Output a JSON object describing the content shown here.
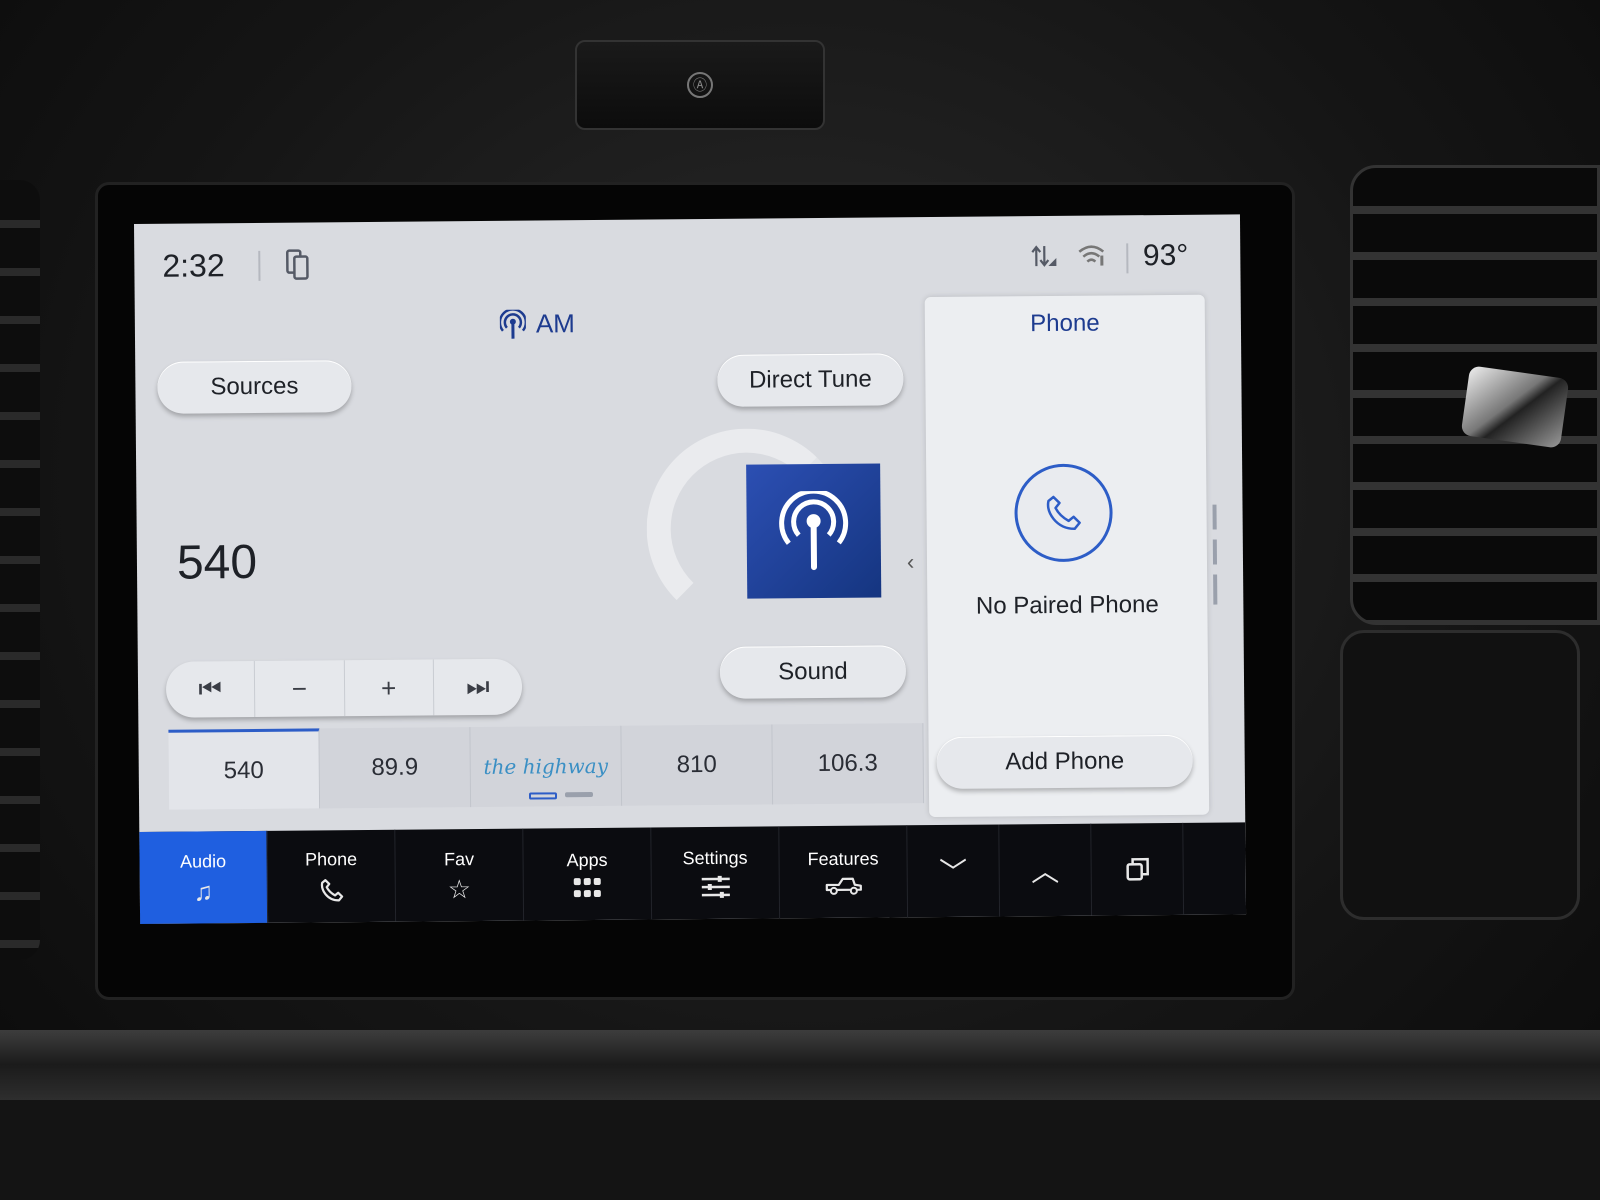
{
  "status_bar": {
    "time": "2:32",
    "temperature": "93°"
  },
  "audio": {
    "source": "AM",
    "sources_label": "Sources",
    "direct_tune_label": "Direct Tune",
    "sound_label": "Sound",
    "frequency": "540",
    "presets": [
      {
        "label": "540",
        "active": true
      },
      {
        "label": "89.9",
        "active": false
      },
      {
        "label": "the highway",
        "active": false,
        "logo": true
      },
      {
        "label": "810",
        "active": false
      },
      {
        "label": "106.3",
        "active": false
      }
    ]
  },
  "phone_panel": {
    "title": "Phone",
    "status": "No Paired Phone",
    "add_label": "Add Phone"
  },
  "nav": {
    "items": [
      {
        "label": "Audio",
        "icon": "music-note-icon",
        "active": true
      },
      {
        "label": "Phone",
        "icon": "phone-icon",
        "active": false
      },
      {
        "label": "Fav",
        "icon": "star-icon",
        "active": false
      },
      {
        "label": "Apps",
        "icon": "apps-grid-icon",
        "active": false
      },
      {
        "label": "Settings",
        "icon": "sliders-icon",
        "active": false
      },
      {
        "label": "Features",
        "icon": "truck-icon",
        "active": false
      }
    ]
  },
  "colors": {
    "accent": "#1f5fe0",
    "title_blue": "#1d3b8f",
    "screen_bg": "#d9dbe0",
    "navbar_bg": "#0b0c10"
  }
}
